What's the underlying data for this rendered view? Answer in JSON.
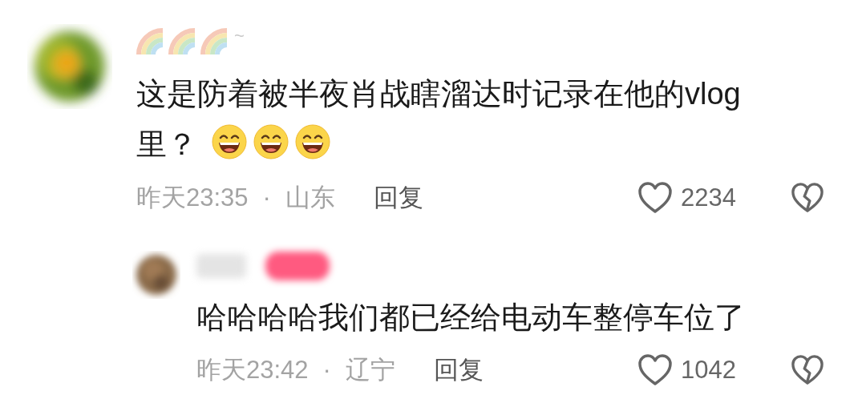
{
  "comments": [
    {
      "kind": "comment",
      "name_suffix": "~",
      "text": "这是防着被半夜肖战瞎溜达时记录在他的vlog里？",
      "emojis": [
        {
          "kind": "grin"
        },
        {
          "kind": "grin"
        },
        {
          "kind": "grin"
        }
      ],
      "time": "昨天23:35",
      "separator": "·",
      "location": "山东",
      "reply_label": "回复",
      "likes": "2234"
    },
    {
      "kind": "reply",
      "text": "哈哈哈哈我们都已经给电动车整停车位了",
      "time": "昨天23:42",
      "separator": "·",
      "location": "辽宁",
      "reply_label": "回复",
      "likes": "1042"
    }
  ]
}
